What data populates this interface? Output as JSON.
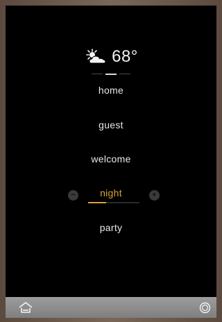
{
  "weather": {
    "icon": "partly-cloudy-icon",
    "temperature": "68°"
  },
  "pager": {
    "count": 3,
    "active_index": 1
  },
  "scenes": [
    {
      "label": "home",
      "active": false
    },
    {
      "label": "guest",
      "active": false
    },
    {
      "label": "welcome",
      "active": false
    },
    {
      "label": "night",
      "active": true
    },
    {
      "label": "party",
      "active": false
    }
  ],
  "dimmer": {
    "minus_label": "−",
    "plus_label": "+",
    "level_fraction": 0.35
  },
  "bottom_bar": {
    "left_icon": "home-icon",
    "right_icon": "power-icon"
  },
  "colors": {
    "accent": "#d7a43e",
    "text": "#e8e8e8",
    "screen": "#000000",
    "bar": "#8c8c8c"
  }
}
